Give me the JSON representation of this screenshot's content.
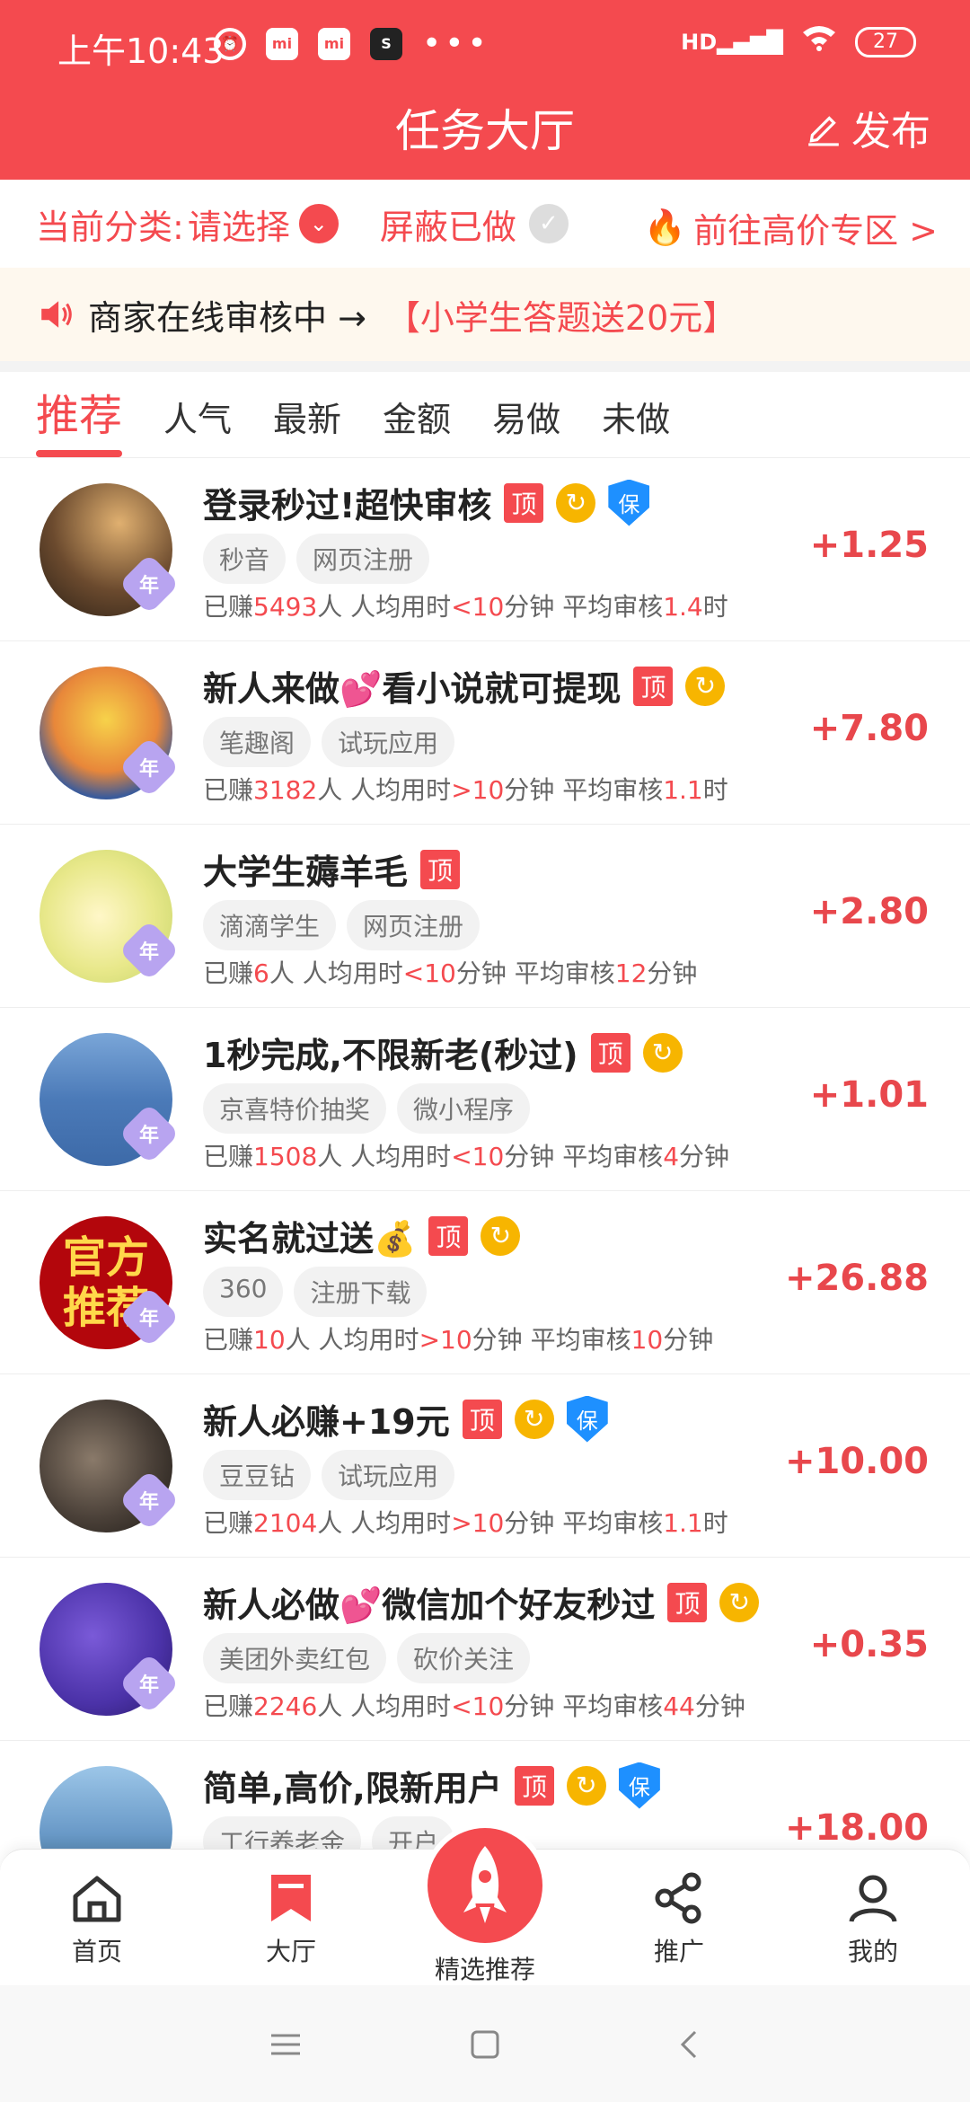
{
  "status": {
    "time": "上午10:43",
    "network": "HD",
    "battery": "27"
  },
  "header": {
    "title": "任务大厅",
    "publish": "发布"
  },
  "category": {
    "label": "当前分类:",
    "select": "请选择",
    "hide_done": "屏蔽已做",
    "high_price": "前往高价专区 >"
  },
  "notice": {
    "text": "商家在线审核中 →",
    "promo": "【小学生答题送20元】"
  },
  "tabs": [
    "推荐",
    "人气",
    "最新",
    "金额",
    "易做",
    "未做"
  ],
  "tasks": [
    {
      "title": "登录秒过!超快审核",
      "tags": [
        "秒音",
        "网页注册"
      ],
      "earned_prefix": "已赚",
      "earned": "5493",
      "earned_suffix": "人 人均用时",
      "time_op": "<",
      "time": "10",
      "time_suffix": "分钟 平均审核",
      "review": "1.4",
      "review_unit": "时",
      "price": "+1.25",
      "refresh": true,
      "bao": true
    },
    {
      "title": "新人来做💕看小说就可提现",
      "tags": [
        "笔趣阁",
        "试玩应用"
      ],
      "earned_prefix": "已赚",
      "earned": "3182",
      "earned_suffix": "人 人均用时",
      "time_op": ">",
      "time": "10",
      "time_suffix": "分钟 平均审核",
      "review": "1.1",
      "review_unit": "时",
      "price": "+7.80",
      "refresh": true,
      "bao": false
    },
    {
      "title": "大学生薅羊毛",
      "tags": [
        "滴滴学生",
        "网页注册"
      ],
      "earned_prefix": "已赚",
      "earned": "6",
      "earned_suffix": "人 人均用时",
      "time_op": "<",
      "time": "10",
      "time_suffix": "分钟 平均审核",
      "review": "12",
      "review_unit": "分钟",
      "price": "+2.80",
      "refresh": false,
      "bao": false
    },
    {
      "title": "1秒完成,不限新老(秒过)",
      "tags": [
        "京喜特价抽奖",
        "微小程序"
      ],
      "earned_prefix": "已赚",
      "earned": "1508",
      "earned_suffix": "人 人均用时",
      "time_op": "<",
      "time": "10",
      "time_suffix": "分钟 平均审核",
      "review": "4",
      "review_unit": "分钟",
      "price": "+1.01",
      "refresh": true,
      "bao": false
    },
    {
      "title": "实名就过送💰",
      "tags": [
        "360",
        "注册下载"
      ],
      "earned_prefix": "已赚",
      "earned": "10",
      "earned_suffix": "人 人均用时",
      "time_op": ">",
      "time": "10",
      "time_suffix": "分钟 平均审核",
      "review": "10",
      "review_unit": "分钟",
      "price": "+26.88",
      "refresh": true,
      "bao": false,
      "avatar_text": "官方推荐"
    },
    {
      "title": "新人必赚+19元",
      "tags": [
        "豆豆钻",
        "试玩应用"
      ],
      "earned_prefix": "已赚",
      "earned": "2104",
      "earned_suffix": "人 人均用时",
      "time_op": ">",
      "time": "10",
      "time_suffix": "分钟 平均审核",
      "review": "1.1",
      "review_unit": "时",
      "price": "+10.00",
      "refresh": true,
      "bao": true
    },
    {
      "title": "新人必做💕微信加个好友秒过",
      "tags": [
        "美团外卖红包",
        "砍价关注"
      ],
      "earned_prefix": "已赚",
      "earned": "2246",
      "earned_suffix": "人 人均用时",
      "time_op": "<",
      "time": "10",
      "time_suffix": "分钟 平均审核",
      "review": "44",
      "review_unit": "分钟",
      "price": "+0.35",
      "refresh": true,
      "bao": false
    },
    {
      "title": "简单,高价,限新用户",
      "tags": [
        "工行养老金",
        "开户"
      ],
      "price": "+18.00",
      "refresh": true,
      "bao": true
    }
  ],
  "badges": {
    "ding": "顶",
    "bao": "保",
    "year": "年"
  },
  "nav": {
    "home": "首页",
    "hall": "大厅",
    "featured": "精选推荐",
    "promote": "推广",
    "mine": "我的"
  }
}
